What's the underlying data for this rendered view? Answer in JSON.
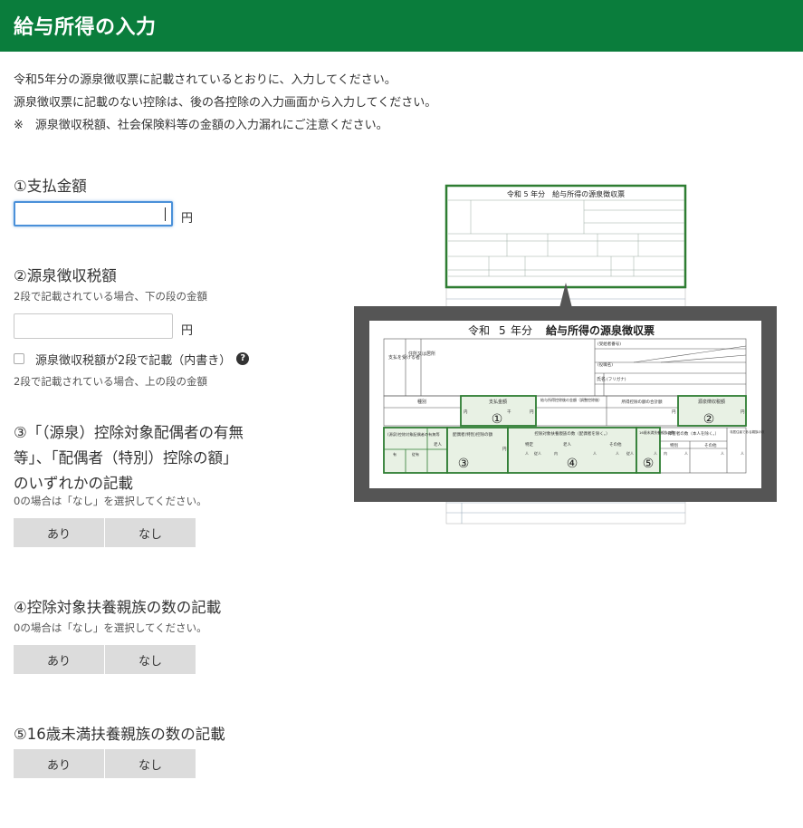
{
  "header": {
    "title": "給与所得の入力"
  },
  "intro": {
    "line1": "令和5年分の源泉徴収票に記載されているとおりに、入力してください。",
    "line2": "源泉徴収票に記載のない控除は、後の各控除の入力画面から入力してください。",
    "line3": "※　源泉徴収税額、社会保険料等の金額の入力漏れにご注意ください。"
  },
  "q1": {
    "title": "①支払金額",
    "value": "",
    "unit": "円"
  },
  "q2": {
    "title": "②源泉徴収税額",
    "note": "2段で記載されている場合、下の段の金額",
    "value": "",
    "unit": "円",
    "checkbox_label": "源泉徴収税額が2段で記載（内書き）",
    "help": "?",
    "note2": "2段で記載されている場合、上の段の金額"
  },
  "q3": {
    "line1": "③「（源泉）控除対象配偶者の有無",
    "line2": "等」、「配偶者（特別）控除の額」",
    "line3": "のいずれかの記載",
    "note": "0の場合は「なし」を選択してください。",
    "yes": "あり",
    "no": "なし"
  },
  "q4": {
    "title": "④控除対象扶養親族の数の記載",
    "note": "0の場合は「なし」を選択してください。",
    "yes": "あり",
    "no": "なし"
  },
  "q5": {
    "title": "⑤16歳未満扶養親族の数の記載",
    "yes": "あり",
    "no": "なし"
  },
  "slip": {
    "title_small": "令和 5 年分　給与所得の源泉徴収票",
    "era": "令和",
    "year": "5",
    "year_suffix": "年分",
    "doc_title": "給与所得の源泉徴収票",
    "payee_label": "支払を受ける者",
    "address_label": "住所又は居所",
    "name_label": "氏名",
    "kana_label": "(フリガナ)",
    "recipient_no_label": "(受給者番号)",
    "position_label": "(役職名)",
    "type_label": "種別",
    "pay_label": "支払金額",
    "after_deduction_label": "給与所得控除後の金額（調整控除後）",
    "total_deduction_label": "所得控除の額の合計額",
    "tax_label": "源泉徴収税額",
    "spouse_label": "(源泉)控除対象配偶者の有無等",
    "elderly_label": "老人",
    "yes_label": "有",
    "subordinate_label": "従有",
    "spouse_deduction_label": "配偶者(特別)控除の額",
    "dependents_label": "控除対象扶養親族の数（配偶者を除く。）",
    "special_label": "特定",
    "elderly2_label": "老人",
    "other_label": "その他",
    "under16_label": "16歳未満扶養親族の数",
    "disabled_label": "障害者の数（本人を除く。）",
    "special2_label": "特別",
    "other2_label": "その他",
    "nonresident_label": "非居住者である親族の数",
    "yen": "円",
    "thousand": "千",
    "person": "人",
    "inside": "内",
    "subordinate_person": "従人",
    "marker1": "①",
    "marker2": "②",
    "marker3": "③",
    "marker4": "④",
    "marker5": "⑤"
  }
}
